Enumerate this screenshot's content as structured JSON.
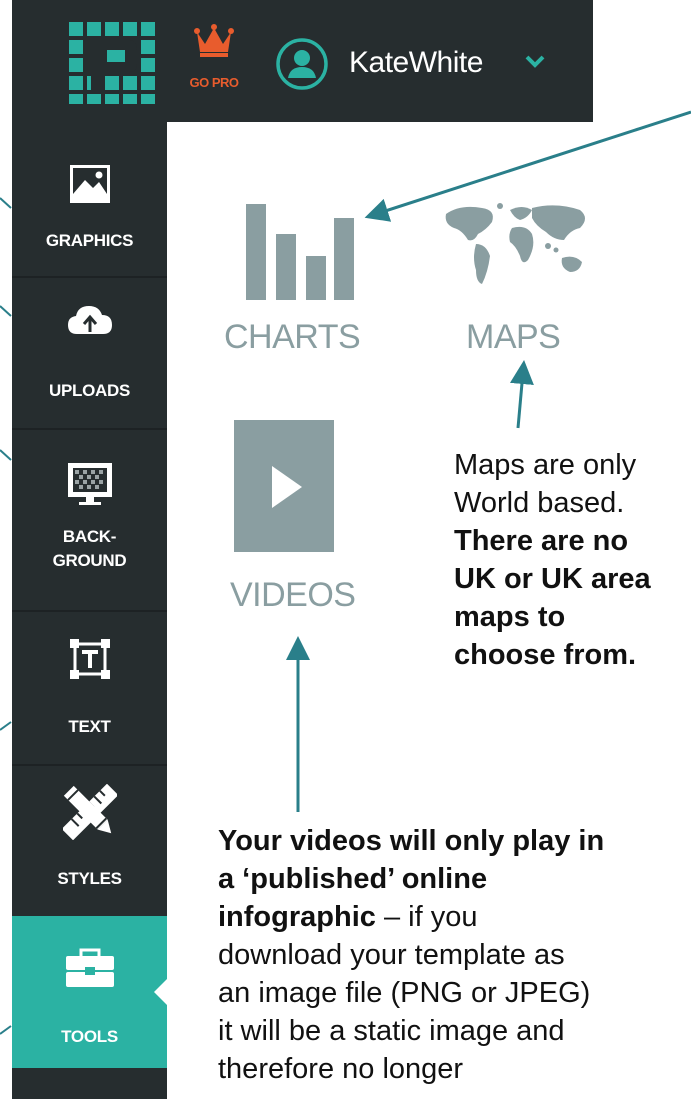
{
  "topbar": {
    "go_pro": "GO PRO",
    "username": "KateWhite"
  },
  "sidebar": {
    "items": [
      {
        "label": "GRAPHICS"
      },
      {
        "label": "UPLOADS"
      },
      {
        "label_line1": "BACK-",
        "label_line2": "GROUND"
      },
      {
        "label": "TEXT"
      },
      {
        "label": "STYLES"
      },
      {
        "label": "TOOLS",
        "active": true
      }
    ]
  },
  "tools": {
    "charts": "CHARTS",
    "maps": "MAPS",
    "videos": "VIDEOS"
  },
  "annotations": {
    "maps_note": {
      "line1": "Maps are only",
      "line2": "World based.",
      "bold1": "There are no",
      "bold2": "UK or UK area",
      "bold3": "maps to",
      "bold4": "choose from."
    },
    "videos_note": {
      "bold1": "Your videos will only play in",
      "bold2": "a ‘published’ online",
      "bold3": "infographic",
      "rest1": " – if you",
      "line4": "download your template as",
      "line5": "an image file (PNG or JPEG)",
      "line6": "it will be a static image and",
      "line7": "therefore no longer"
    }
  },
  "colors": {
    "sidebar_bg": "#262d2f",
    "active_teal": "#2bb2a3",
    "tool_grey": "#8a9ea1",
    "annotation_arrow": "#2a7f8a",
    "gopro_orange": "#e85c2d"
  }
}
